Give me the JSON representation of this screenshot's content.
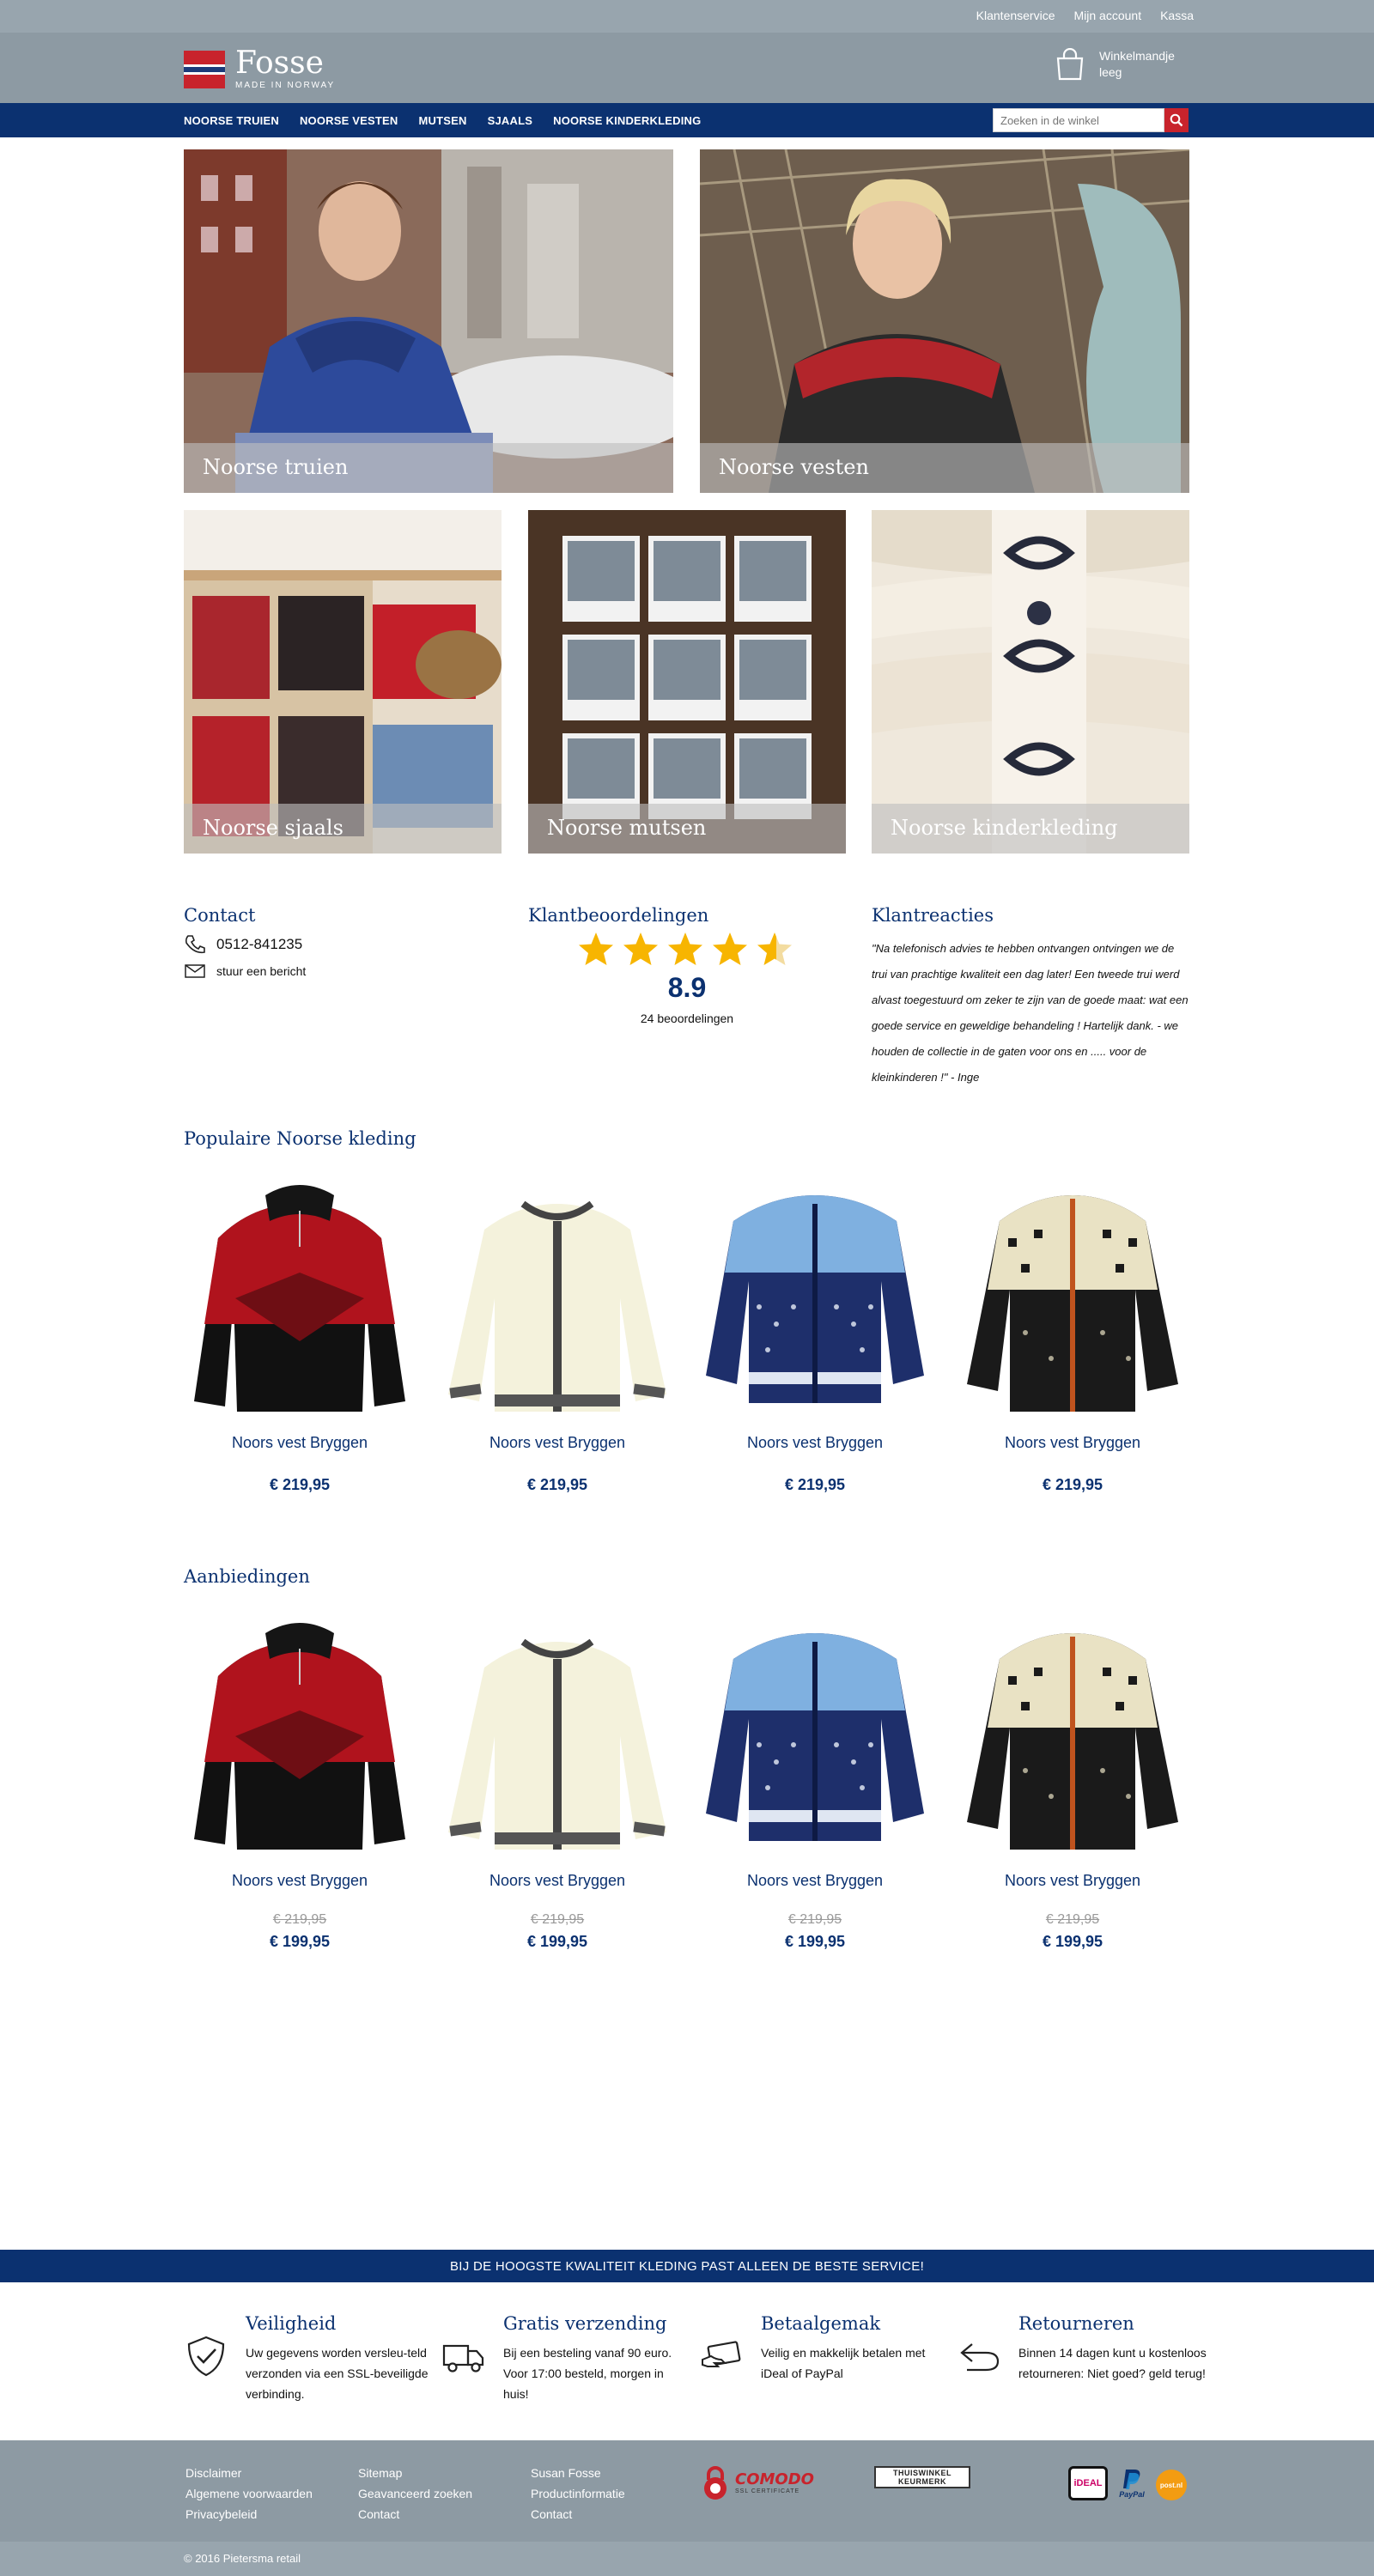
{
  "top_links": [
    "Klantenservice",
    "Mijn account",
    "Kassa"
  ],
  "logo": {
    "brand": "Fosse",
    "tagline": "MADE IN NORWAY"
  },
  "cart": {
    "label": "Winkelmandje",
    "status": "leeg"
  },
  "nav": {
    "items": [
      "NOORSE TRUIEN",
      "NOORSE VESTEN",
      "MUTSEN",
      "SJAALS",
      "NOORSE KINDERKLEDING"
    ],
    "search_placeholder": "Zoeken in de winkel"
  },
  "categories": [
    "Noorse truien",
    "Noorse vesten",
    "Noorse sjaals",
    "Noorse mutsen",
    "Noorse kinderkleding"
  ],
  "contact": {
    "heading": "Contact",
    "phone": "0512-841235",
    "message": "stuur een bericht"
  },
  "ratings": {
    "heading": "Klantbeoordelingen",
    "score": "8.9",
    "count": "24 beoordelingen",
    "stars": 4.5
  },
  "reviews": {
    "heading": "Klantreacties",
    "text": "\"Na telefonisch advies te hebben ontvangen ontvingen we de trui van prachtige kwaliteit een dag later! Een tweede trui werd alvast toegestuurd om zeker te zijn van de goede maat: wat een goede service en geweldige behandeling ! Hartelijk dank. - we houden de collectie in de gaten voor ons en ..... voor de kleinkinderen !\" - Inge"
  },
  "popular": {
    "heading": "Populaire Noorse kleding",
    "products": [
      {
        "name": "Noors vest Bryggen",
        "price": "€ 219,95",
        "style": "red-pullover"
      },
      {
        "name": "Noors vest Bryggen",
        "price": "€ 219,95",
        "style": "cream-cardigan"
      },
      {
        "name": "Noors vest Bryggen",
        "price": "€ 219,95",
        "style": "blue-cardigan"
      },
      {
        "name": "Noors vest Bryggen",
        "price": "€ 219,95",
        "style": "black-cardigan"
      }
    ]
  },
  "offers": {
    "heading": "Aanbiedingen",
    "products": [
      {
        "name": "Noors vest Bryggen",
        "old_price": "€ 219,95",
        "price": "€ 199,95",
        "style": "red-pullover"
      },
      {
        "name": "Noors vest Bryggen",
        "old_price": "€ 219,95",
        "price": "€ 199,95",
        "style": "cream-cardigan"
      },
      {
        "name": "Noors vest Bryggen",
        "old_price": "€ 219,95",
        "price": "€ 199,95",
        "style": "blue-cardigan"
      },
      {
        "name": "Noors vest Bryggen",
        "old_price": "€ 219,95",
        "price": "€ 199,95",
        "style": "black-cardigan"
      }
    ]
  },
  "service_banner": "BIJ DE HOOGSTE KWALITEIT KLEDING PAST ALLEEN DE BESTE SERVICE!",
  "usps": [
    {
      "title": "Veiligheid",
      "text": "Uw gegevens worden versleu-teld verzonden via een SSL-beveiligde verbinding.",
      "icon": "shield-icon"
    },
    {
      "title": "Gratis verzending",
      "text": "Bij een besteling vanaf 90 euro. Voor 17:00 besteld, morgen in huis!",
      "icon": "truck-icon"
    },
    {
      "title": "Betaalgemak",
      "text": "Veilig en makkelijk betalen met iDeal of PayPal",
      "icon": "payment-card-icon"
    },
    {
      "title": "Retourneren",
      "text": "Binnen 14 dagen kunt u kostenloos retourneren: Niet goed? geld terug!",
      "icon": "return-arrow-icon"
    }
  ],
  "footer": {
    "col1": [
      "Disclaimer",
      "Algemene voorwaarden",
      "Privacybeleid"
    ],
    "col2": [
      "Sitemap",
      "Geavanceerd zoeken",
      "Contact"
    ],
    "col3": [
      "Susan Fosse",
      "Productinformatie",
      "Contact"
    ],
    "comodo": {
      "name": "COMODO",
      "sub": "SSL CERTIFICATE"
    },
    "thuiswinkel": "THUISWINKEL KEURMERK",
    "payments": {
      "ideal": "iDEAL",
      "paypal": "PayPal",
      "postnl": "post.nl"
    }
  },
  "copyright": "© 2016 Pietersma retail",
  "colors": {
    "navy": "#0b3170",
    "header_grey": "#8d9aa3",
    "accent_red": "#c8232c",
    "star": "#f7b500"
  }
}
